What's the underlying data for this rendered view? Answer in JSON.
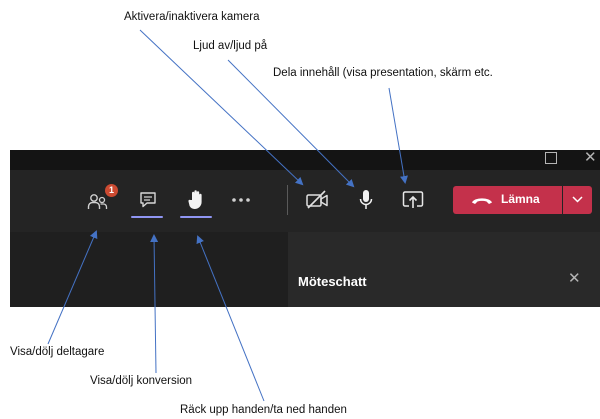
{
  "annotations": {
    "camera": "Aktivera/inaktivera kamera",
    "mic": "Ljud av/ljud på",
    "share": "Dela innehåll (visa presentation, skärm etc.",
    "participants": "Visa/dölj deltagare",
    "chat": "Visa/dölj konversion",
    "hand": "Räck upp handen/ta ned handen"
  },
  "toolbar": {
    "participants_badge": "1",
    "leave_label": "Lämna"
  },
  "chat_panel": {
    "title": "Möteschatt"
  },
  "icons": {
    "participants": "people-icon",
    "chat": "chat-icon",
    "hand": "raise-hand-icon",
    "more": "more-icon",
    "camera": "camera-off-icon",
    "mic": "microphone-icon",
    "share": "share-screen-icon",
    "leave": "phone-hangup-icon",
    "dropdown": "chevron-down-icon"
  },
  "colors": {
    "arrow": "#4472c4",
    "leave_button": "#c4314b",
    "badge": "#cc4a31",
    "active_underline": "#8f95f2",
    "toolbar": "#242424"
  }
}
